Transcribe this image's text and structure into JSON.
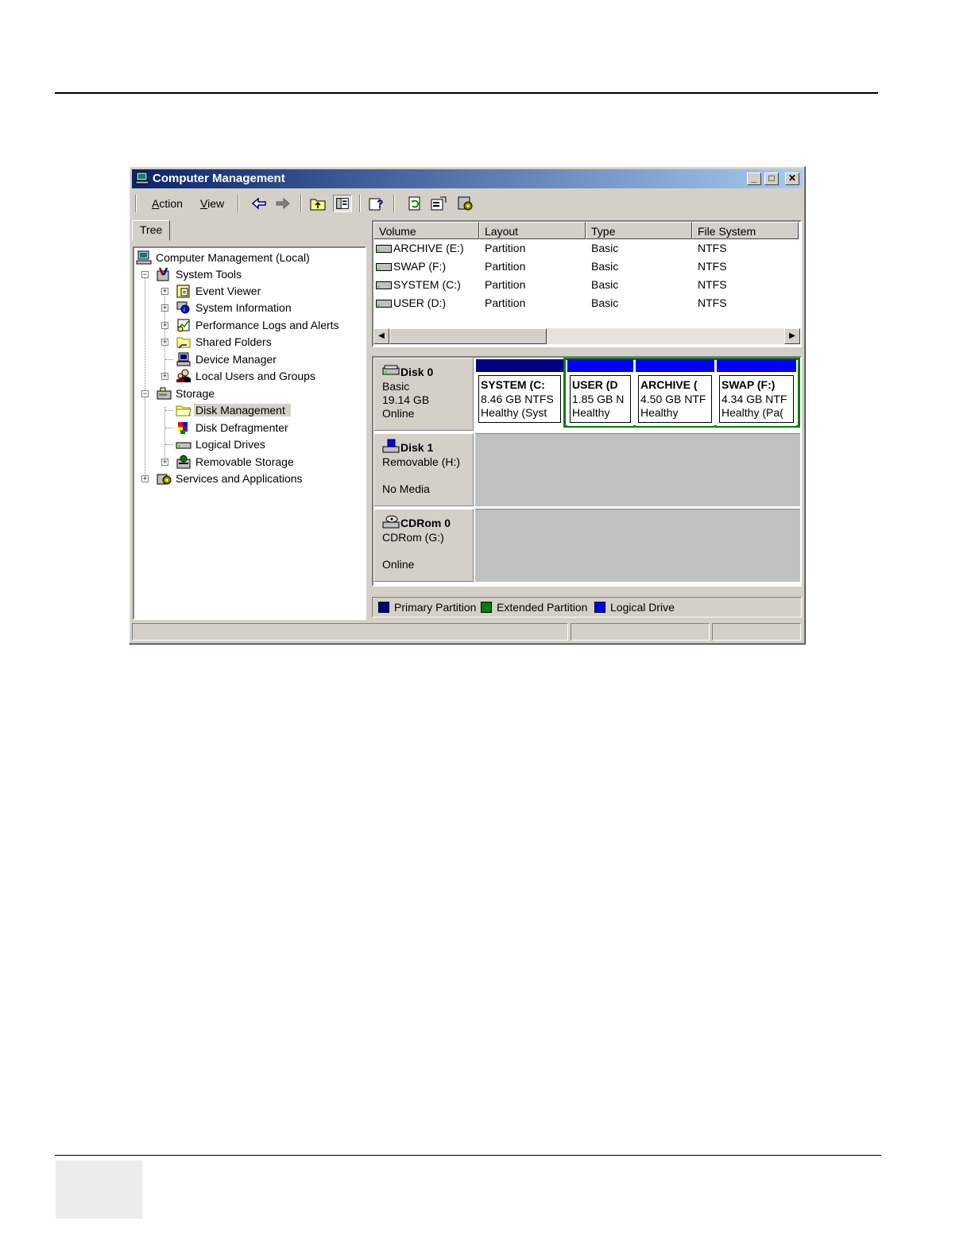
{
  "window": {
    "title": "Computer Management",
    "minimize": "_",
    "maximize": "□",
    "close": "✕"
  },
  "menu": [
    {
      "label": "Action",
      "underline": "A",
      "rest": "ction"
    },
    {
      "label": "View",
      "underline": "V",
      "rest": "iew"
    }
  ],
  "toolbar_icons": [
    "back-arrow-icon",
    "forward-arrow-icon",
    "up-folder-icon",
    "show-hide-tree-icon",
    "help-icon",
    "refresh-icon",
    "properties-icon",
    "settings-icon"
  ],
  "tree_tab": "Tree",
  "tree": {
    "root": "Computer Management (Local)",
    "system_tools": "System Tools",
    "event_viewer": "Event Viewer",
    "system_information": "System Information",
    "perf_logs": "Performance Logs and Alerts",
    "shared_folders": "Shared Folders",
    "device_manager": "Device Manager",
    "local_users": "Local Users and Groups",
    "storage": "Storage",
    "disk_management": "Disk Management",
    "disk_defragmenter": "Disk Defragmenter",
    "logical_drives": "Logical Drives",
    "removable_storage": "Removable Storage",
    "services": "Services and Applications"
  },
  "volume_list": {
    "headers": [
      "Volume",
      "Layout",
      "Type",
      "File System"
    ],
    "rows": [
      [
        "ARCHIVE (E:)",
        "Partition",
        "Basic",
        "NTFS"
      ],
      [
        "SWAP (F:)",
        "Partition",
        "Basic",
        "NTFS"
      ],
      [
        "SYSTEM (C:)",
        "Partition",
        "Basic",
        "NTFS"
      ],
      [
        "USER (D:)",
        "Partition",
        "Basic",
        "NTFS"
      ]
    ]
  },
  "disks": {
    "disk0": {
      "name": "Disk 0",
      "type": "Basic",
      "size": "19.14 GB",
      "status": "Online",
      "partitions": [
        {
          "name": "SYSTEM  (C:",
          "size": "8.46 GB NTFS",
          "status": "Healthy (Syst"
        },
        {
          "name": "USER  (D",
          "size": "1.85 GB N",
          "status": "Healthy"
        },
        {
          "name": "ARCHIVE  (",
          "size": "4.50 GB NTF",
          "status": "Healthy"
        },
        {
          "name": "SWAP  (F:)",
          "size": "4.34 GB NTF",
          "status": "Healthy (Pa("
        }
      ]
    },
    "disk1": {
      "name": "Disk 1",
      "type": "Removable (H:)",
      "status": "No Media"
    },
    "cdrom0": {
      "name": "CDRom 0",
      "type": "CDRom (G:)",
      "status": "Online"
    }
  },
  "legend": {
    "primary": "Primary Partition",
    "extended": "Extended Partition",
    "logical": "Logical Drive"
  },
  "colors": {
    "primary": "#000080",
    "extended": "#008000",
    "logical": "#0000ff",
    "title_start": "#0a246a",
    "title_end": "#a6caf0",
    "face": "#d4d0c8"
  }
}
